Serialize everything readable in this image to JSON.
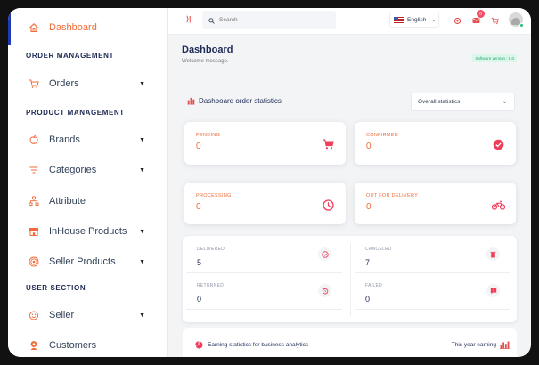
{
  "colors": {
    "accent": "#ef6c3a",
    "navy": "#1e2a55",
    "active_bar": "#1f3bb3",
    "badge": "#ee4f67",
    "success": "#1ec37a"
  },
  "sidebar": {
    "items": [
      {
        "label": "Dashboard",
        "icon": "home-icon",
        "active": true
      },
      {
        "section": "ORDER MANAGEMENT"
      },
      {
        "label": "Orders",
        "icon": "cart-icon",
        "has_submenu": true
      },
      {
        "section": "PRODUCT MANAGEMENT"
      },
      {
        "label": "Brands",
        "icon": "apple-icon",
        "has_submenu": true
      },
      {
        "label": "Categories",
        "icon": "filter-icon",
        "has_submenu": true
      },
      {
        "label": "Attribute",
        "icon": "sitemap-icon"
      },
      {
        "label": "InHouse Products",
        "icon": "store-icon",
        "has_submenu": true
      },
      {
        "label": "Seller Products",
        "icon": "broadcast-icon",
        "has_submenu": true
      },
      {
        "section": "USER SECTION"
      },
      {
        "label": "Seller",
        "icon": "emoji-icon",
        "has_submenu": true
      },
      {
        "label": "Customers",
        "icon": "user-icon"
      }
    ]
  },
  "topbar": {
    "collapse_glyph": "⟩|",
    "search_placeholder": "Search",
    "language": "English",
    "message_count": "0",
    "order_count": "0"
  },
  "page": {
    "title": "Dashboard",
    "welcome": "Welcome message.",
    "version": "Software version : 9.0"
  },
  "order_stats": {
    "heading": "Dashboard order statistics",
    "filter_value": "Overall statistics",
    "cards": [
      {
        "label": "PENDING",
        "value": "0",
        "icon": "shopping-cart-icon"
      },
      {
        "label": "CONFIRMED",
        "value": "0",
        "icon": "check-circle-icon"
      },
      {
        "label": "PROCESSING",
        "value": "0",
        "icon": "clock-icon"
      },
      {
        "label": "OUT FOR DELIVERY",
        "value": "0",
        "icon": "bike-icon"
      }
    ],
    "summary": [
      {
        "label": "DELIVERED",
        "value": "5",
        "icon": "check-icon"
      },
      {
        "label": "CANCELED",
        "value": "7",
        "icon": "trash-icon"
      },
      {
        "label": "RETURNED",
        "value": "0",
        "icon": "return-icon"
      },
      {
        "label": "FAILED",
        "value": "0",
        "icon": "alert-message-icon"
      }
    ]
  },
  "earning": {
    "heading": "Earning statistics for business analytics",
    "period": "This year earning"
  }
}
